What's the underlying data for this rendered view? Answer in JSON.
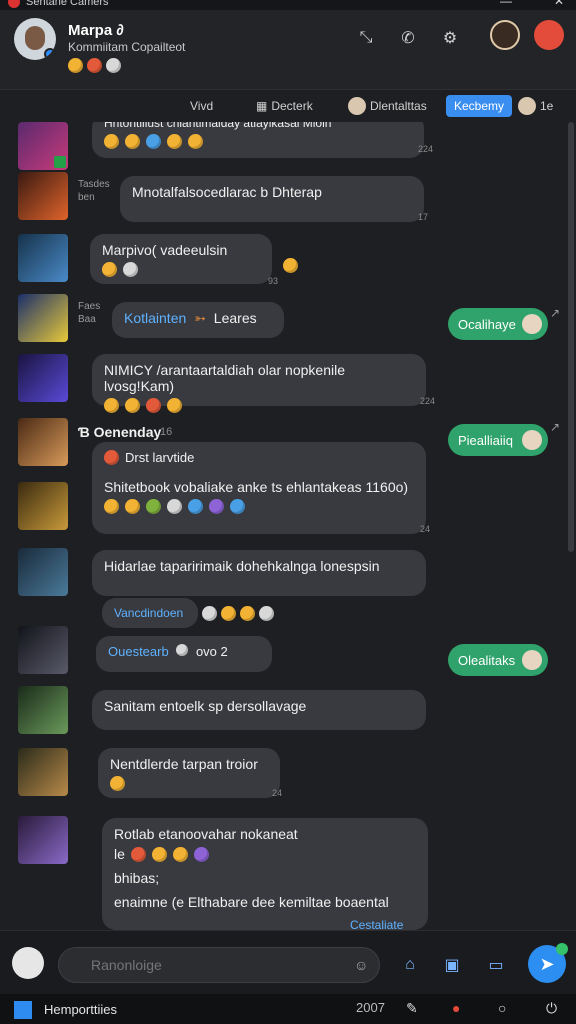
{
  "titlebar": {
    "title": "Sentane Camers",
    "win_min": "—",
    "win_close": "✕"
  },
  "header": {
    "name": "Marpa ∂",
    "status": "Kommiitam Copailteot",
    "icons": [
      "collapse-icon",
      "phone-icon",
      "settings-icon"
    ]
  },
  "tabs": [
    {
      "label": "Vivd"
    },
    {
      "label": "Decterk"
    },
    {
      "label": "Dlentalttas"
    },
    {
      "label": "Kecbemy",
      "count": "1e"
    }
  ],
  "messages": [
    {
      "text": "Hhtontlilust chiantimalday atlaylkasal Mioln",
      "stamp": "224"
    },
    {
      "meta": [
        "Tasdes",
        "ben"
      ],
      "text": "Mnotalfalsocedlarac b Dhterap",
      "stamp": "17"
    },
    {
      "text": "Marpivo( vadeeulsin",
      "stamp": "93"
    },
    {
      "meta": [
        "Faes",
        "Baa"
      ],
      "text": "Kotlainten",
      "link_tail": "Leares",
      "pill": "Ocalihaye"
    },
    {
      "text": "NIMICY /arantaartaldiah olar nopkenile lvosg!Kam)",
      "stamp": "224"
    },
    {
      "sender": "Ɓ Oenenday",
      "sender_meta": "16",
      "pill": "Piealliaiiq"
    },
    {
      "title": "Drst larvtide",
      "text": "Shitetbook vobaliake anke ts ehlantakeas 1160o)",
      "stamp": "24"
    },
    {
      "text": "Hidarlae taparirimaik dohehkalnga lonespsin",
      "reply": "Vancdindoen"
    },
    {
      "link": "Ouestearb",
      "tail": "ovo 2",
      "pill": "Olealitaks"
    },
    {
      "text": "Sanitam entoelk sp dersollavage"
    },
    {
      "text": "Nentdlerde tarpan troior",
      "stamp": "24"
    },
    {
      "title": "Rotlab etanoovahar nokaneat",
      "l2": "le",
      "l3": "bhibas;",
      "l4": "enaimne (e Elthabare dee kemiltae boaental",
      "link": "Cestaliate"
    }
  ],
  "composer": {
    "placeholder": "Ranonloige"
  },
  "taskbar": {
    "label": "Hemporttiies",
    "time": "2007"
  }
}
